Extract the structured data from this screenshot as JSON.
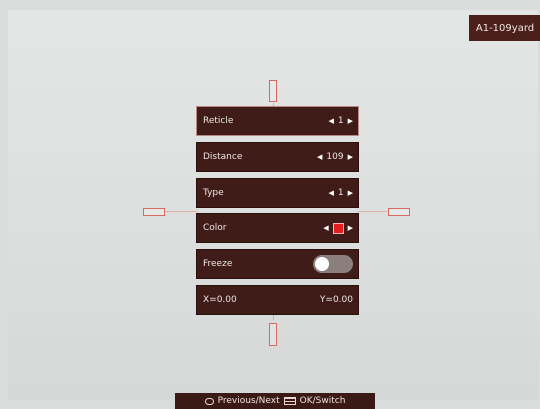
{
  "profile_tag": "A1-109yard",
  "menu": {
    "items": [
      {
        "label": "Reticle",
        "value": "1"
      },
      {
        "label": "Distance",
        "value": "109"
      },
      {
        "label": "Type",
        "value": "1"
      },
      {
        "label": "Color",
        "value_color": "#e41d1d"
      },
      {
        "label": "Freeze",
        "toggle_state": "off"
      }
    ],
    "coords": {
      "x": "X=0.00",
      "y": "Y=0.00"
    }
  },
  "hint_bar": {
    "previous_next": "Previous/Next",
    "ok_switch": "OK/Switch"
  }
}
